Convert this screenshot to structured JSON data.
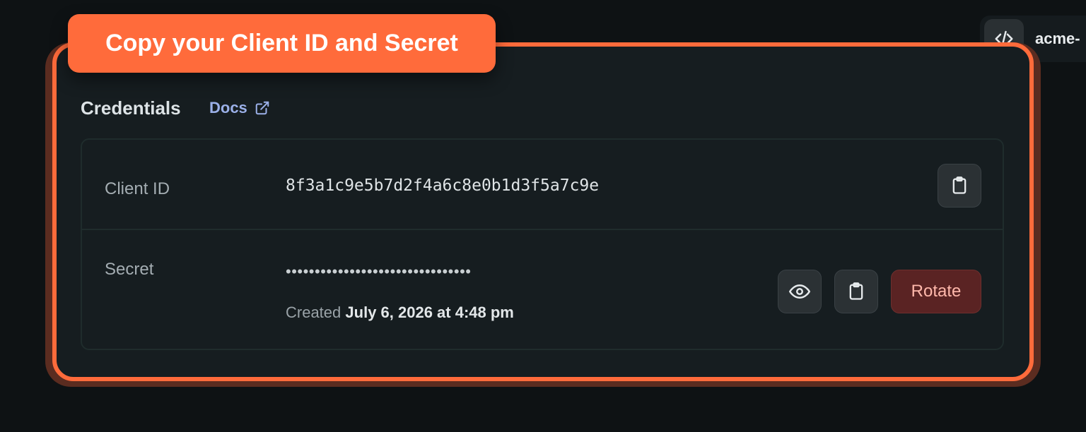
{
  "tooltip": {
    "text": "Copy your Client ID and Secret"
  },
  "header": {
    "project_name": "acme-"
  },
  "card": {
    "title": "Credentials",
    "docs_label": "Docs"
  },
  "client_id": {
    "label": "Client ID",
    "value": "8f3a1c9e5b7d2f4a6c8e0b1d3f5a7c9e"
  },
  "secret": {
    "label": "Secret",
    "masked_value": "••••••••••••••••••••••••••••••••",
    "created_prefix": "Created",
    "created_date": "July 6, 2026 at 4:48 pm",
    "rotate_label": "Rotate"
  },
  "colors": {
    "accent": "#ff6b3b",
    "background": "#0e1214",
    "card": "#161d20",
    "link": "#9bb0e8",
    "danger_bg": "#5a2323",
    "danger_text": "#ffb8ab"
  },
  "icons": {
    "code": "code-icon",
    "external_link": "external-link-icon",
    "copy": "clipboard-icon",
    "reveal": "eye-icon"
  }
}
